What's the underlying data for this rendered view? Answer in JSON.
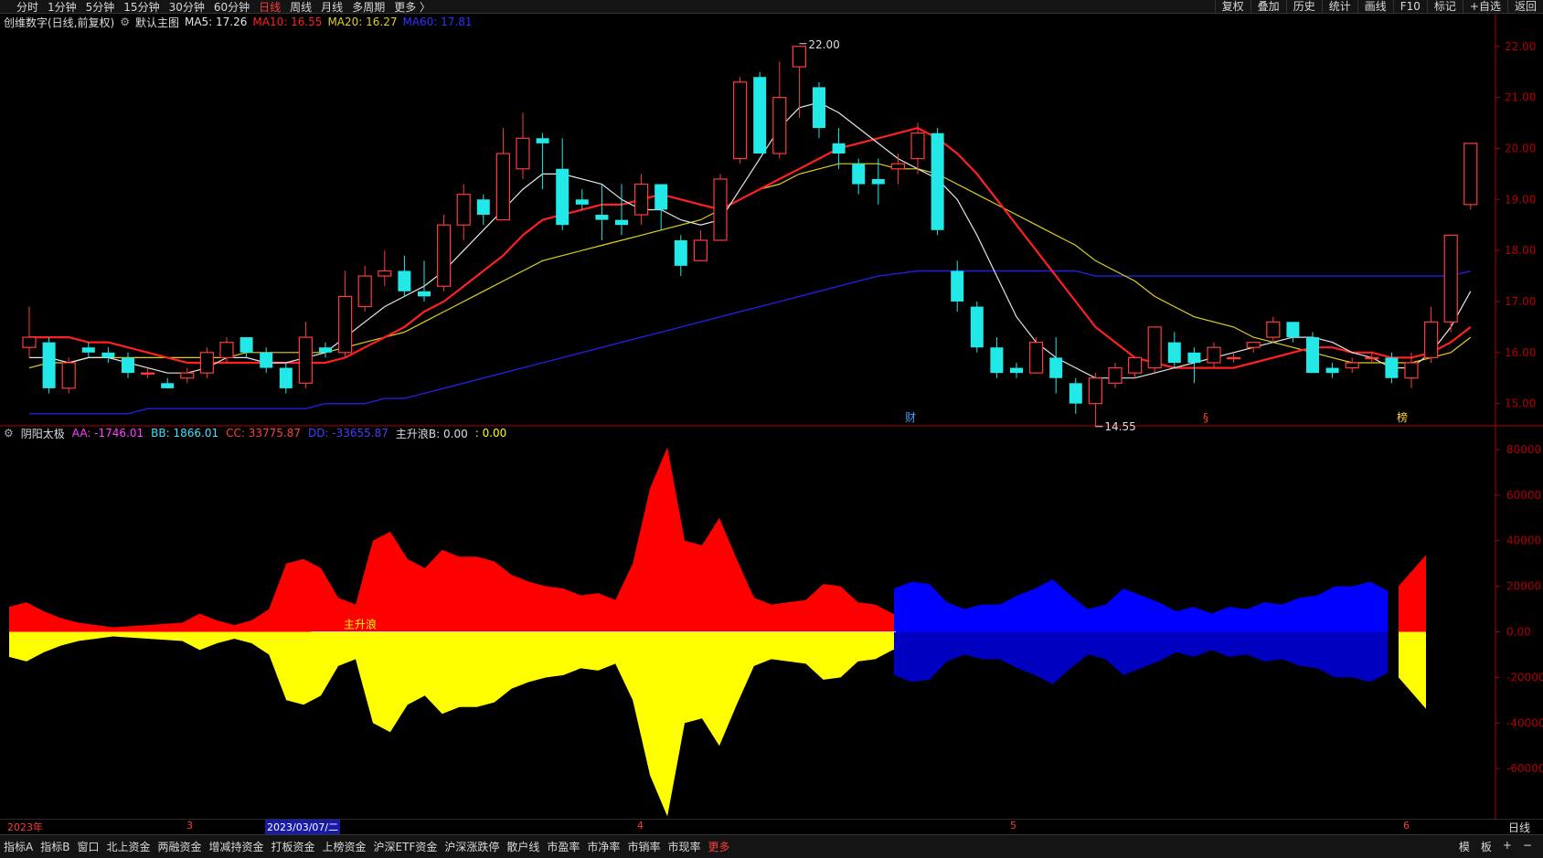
{
  "top_toolbar": {
    "periods": [
      "分时",
      "1分钟",
      "5分钟",
      "15分钟",
      "30分钟",
      "60分钟",
      "日线",
      "周线",
      "月线",
      "多周期",
      "更多 〉"
    ],
    "active_period": "日线",
    "tools": [
      "复权",
      "叠加",
      "历史",
      "统计",
      "画线",
      "F10",
      "标记",
      "+自选",
      "返回"
    ]
  },
  "main_legend": {
    "name": "创维数字(日线,前复权)",
    "main_chart": "默认主图",
    "ma5": "MA5: 17.26",
    "ma10": "MA10: 16.55",
    "ma20": "MA20: 16.27",
    "ma60": "MA60: 17.81"
  },
  "indicator_legend": {
    "name": "阴阳太极",
    "aa": "AA: -1746.01",
    "bb": "BB: 1866.01",
    "cc": "CC: 33775.87",
    "dd": "DD: -33655.87",
    "zsl": "主升浪B: 0.00",
    "extra": ": 0.00",
    "zsl_mark": "主升浪"
  },
  "colors": {
    "up": "#ff3b3b",
    "down": "#22e8e8",
    "ma5": "#e6e6e6",
    "ma10": "#ff2020",
    "ma20": "#e0d020",
    "ma60": "#2020e0",
    "axis": "#b00000",
    "aa": "#ff40ff",
    "bb": "#40e0ff",
    "cc": "#ff4040",
    "dd": "#4040ff",
    "yellow": "#ffff00"
  },
  "chart_data": [
    {
      "type": "candlestick",
      "title": "创维数字(日线,前复权)",
      "ylim": [
        14.6,
        22.3
      ],
      "y_ticks": [
        "22.00",
        "21.00",
        "20.00",
        "19.00",
        "18.00",
        "17.00",
        "16.00",
        "15.00"
      ],
      "annotations": {
        "high": "22.00",
        "low": "14.55",
        "event1": "财",
        "event2": "§",
        "event3": "榜"
      },
      "candles": [
        [
          16.1,
          16.3,
          16.9,
          15.9
        ],
        [
          16.2,
          15.3,
          16.3,
          15.2
        ],
        [
          15.3,
          15.8,
          15.9,
          15.2
        ],
        [
          16.1,
          16.0,
          16.2,
          15.9
        ],
        [
          16.0,
          15.9,
          16.1,
          15.8
        ],
        [
          15.9,
          15.6,
          16.0,
          15.5
        ],
        [
          15.6,
          15.6,
          15.7,
          15.5
        ],
        [
          15.4,
          15.3,
          15.5,
          15.3
        ],
        [
          15.5,
          15.6,
          15.7,
          15.4
        ],
        [
          15.6,
          16.0,
          16.1,
          15.5
        ],
        [
          15.9,
          16.2,
          16.3,
          15.8
        ],
        [
          16.3,
          16.0,
          16.3,
          15.9
        ],
        [
          16.0,
          15.7,
          16.1,
          15.6
        ],
        [
          15.7,
          15.3,
          15.8,
          15.2
        ],
        [
          15.4,
          16.3,
          16.6,
          15.3
        ],
        [
          16.1,
          16.0,
          16.2,
          15.9
        ],
        [
          16.0,
          17.1,
          17.6,
          15.9
        ],
        [
          16.9,
          17.5,
          17.7,
          16.8
        ],
        [
          17.5,
          17.6,
          18.0,
          17.3
        ],
        [
          17.6,
          17.2,
          17.9,
          17.1
        ],
        [
          17.2,
          17.1,
          17.8,
          17.0
        ],
        [
          17.3,
          18.5,
          18.7,
          17.2
        ],
        [
          18.5,
          19.1,
          19.3,
          18.2
        ],
        [
          19.0,
          18.7,
          19.1,
          18.5
        ],
        [
          18.6,
          19.9,
          20.4,
          18.6
        ],
        [
          19.6,
          20.2,
          20.7,
          19.4
        ],
        [
          20.2,
          20.1,
          20.3,
          19.2
        ],
        [
          19.6,
          18.5,
          20.2,
          18.4
        ],
        [
          19.0,
          18.9,
          19.2,
          18.8
        ],
        [
          18.7,
          18.6,
          19.3,
          18.2
        ],
        [
          18.6,
          18.5,
          19.3,
          18.3
        ],
        [
          18.7,
          19.3,
          19.5,
          18.5
        ],
        [
          19.3,
          18.8,
          19.3,
          18.4
        ],
        [
          18.2,
          17.7,
          18.3,
          17.5
        ],
        [
          17.8,
          18.2,
          18.4,
          17.8
        ],
        [
          18.2,
          19.4,
          19.5,
          18.2
        ],
        [
          19.8,
          21.3,
          21.4,
          19.7
        ],
        [
          21.4,
          19.9,
          21.5,
          19.9
        ],
        [
          19.9,
          21.0,
          21.7,
          19.8
        ],
        [
          21.6,
          22.0,
          22.0,
          20.6
        ],
        [
          21.2,
          20.4,
          21.3,
          20.2
        ],
        [
          20.1,
          19.9,
          20.4,
          19.6
        ],
        [
          19.7,
          19.3,
          19.8,
          19.1
        ],
        [
          19.4,
          19.3,
          19.8,
          18.9
        ],
        [
          19.6,
          19.7,
          19.9,
          19.3
        ],
        [
          19.8,
          20.3,
          20.5,
          19.5
        ],
        [
          20.3,
          18.4,
          20.4,
          18.3
        ],
        [
          17.6,
          17.0,
          17.8,
          16.8
        ],
        [
          16.9,
          16.1,
          17.0,
          16.0
        ],
        [
          16.1,
          15.6,
          16.3,
          15.5
        ],
        [
          15.7,
          15.6,
          15.8,
          15.5
        ],
        [
          15.6,
          16.2,
          16.3,
          15.6
        ],
        [
          15.9,
          15.5,
          16.3,
          15.2
        ],
        [
          15.4,
          15.0,
          15.5,
          14.8
        ],
        [
          15.0,
          15.5,
          15.6,
          14.55
        ],
        [
          15.4,
          15.7,
          15.8,
          15.3
        ],
        [
          15.6,
          15.9,
          15.9,
          15.5
        ],
        [
          15.7,
          16.5,
          16.5,
          15.6
        ],
        [
          16.2,
          15.8,
          16.4,
          15.7
        ],
        [
          16.0,
          15.8,
          16.1,
          15.4
        ],
        [
          15.8,
          16.1,
          16.2,
          15.7
        ],
        [
          15.9,
          15.9,
          16.0,
          15.8
        ],
        [
          16.1,
          16.2,
          16.2,
          16.0
        ],
        [
          16.3,
          16.6,
          16.7,
          16.2
        ],
        [
          16.6,
          16.3,
          16.6,
          16.2
        ],
        [
          16.3,
          15.6,
          16.4,
          15.6
        ],
        [
          15.7,
          15.6,
          15.8,
          15.5
        ],
        [
          15.7,
          15.8,
          15.9,
          15.6
        ],
        [
          15.9,
          15.9,
          16.0,
          15.8
        ],
        [
          15.9,
          15.5,
          16.0,
          15.4
        ],
        [
          15.5,
          15.8,
          16.0,
          15.3
        ],
        [
          15.9,
          16.6,
          16.9,
          15.8
        ],
        [
          16.6,
          18.3,
          18.3,
          16.4
        ],
        [
          18.9,
          20.1,
          20.1,
          18.8
        ]
      ],
      "ma5": [
        15.9,
        15.9,
        15.8,
        15.9,
        15.9,
        15.8,
        15.7,
        15.6,
        15.6,
        15.7,
        15.9,
        15.9,
        15.8,
        15.8,
        15.9,
        16.0,
        16.3,
        16.6,
        16.9,
        17.1,
        17.3,
        17.6,
        18.0,
        18.4,
        18.8,
        19.2,
        19.5,
        19.5,
        19.4,
        19.3,
        19.0,
        18.8,
        18.8,
        18.6,
        18.5,
        18.6,
        19.2,
        19.8,
        20.4,
        20.8,
        20.9,
        20.7,
        20.4,
        20.1,
        19.8,
        19.6,
        19.4,
        19.0,
        18.3,
        17.5,
        16.7,
        16.2,
        15.9,
        15.7,
        15.5,
        15.5,
        15.5,
        15.6,
        15.7,
        15.8,
        15.9,
        16.0,
        16.1,
        16.2,
        16.3,
        16.3,
        16.2,
        16.0,
        15.9,
        15.7,
        15.7,
        16.0,
        16.5,
        17.2
      ],
      "ma10": [
        16.3,
        16.3,
        16.3,
        16.2,
        16.2,
        16.1,
        16.0,
        15.9,
        15.8,
        15.8,
        15.8,
        15.8,
        15.8,
        15.8,
        15.8,
        15.8,
        15.9,
        16.1,
        16.3,
        16.5,
        16.8,
        17.0,
        17.3,
        17.6,
        17.9,
        18.3,
        18.6,
        18.7,
        18.8,
        18.9,
        18.9,
        19.0,
        19.1,
        19.0,
        18.9,
        18.8,
        19.0,
        19.2,
        19.4,
        19.6,
        19.8,
        20.0,
        20.1,
        20.2,
        20.3,
        20.4,
        20.2,
        19.9,
        19.5,
        19.0,
        18.5,
        18.0,
        17.5,
        17.0,
        16.5,
        16.2,
        15.9,
        15.8,
        15.7,
        15.7,
        15.7,
        15.7,
        15.8,
        15.9,
        16.0,
        16.1,
        16.1,
        16.0,
        16.0,
        15.9,
        15.9,
        16.0,
        16.2,
        16.5
      ],
      "ma20": [
        15.7,
        15.8,
        15.8,
        15.9,
        15.9,
        15.9,
        15.9,
        15.9,
        15.9,
        15.9,
        15.9,
        16.0,
        16.0,
        16.0,
        16.0,
        16.0,
        16.1,
        16.2,
        16.3,
        16.4,
        16.6,
        16.8,
        17.0,
        17.2,
        17.4,
        17.6,
        17.8,
        17.9,
        18.0,
        18.1,
        18.2,
        18.3,
        18.4,
        18.5,
        18.6,
        18.8,
        19.0,
        19.2,
        19.3,
        19.5,
        19.6,
        19.7,
        19.7,
        19.7,
        19.6,
        19.6,
        19.5,
        19.3,
        19.1,
        18.9,
        18.7,
        18.5,
        18.3,
        18.1,
        17.8,
        17.6,
        17.4,
        17.1,
        16.9,
        16.7,
        16.6,
        16.5,
        16.3,
        16.2,
        16.1,
        16.0,
        15.9,
        15.8,
        15.8,
        15.8,
        15.8,
        15.9,
        16.0,
        16.3
      ],
      "ma60": [
        14.8,
        14.8,
        14.8,
        14.8,
        14.8,
        14.8,
        14.9,
        14.9,
        14.9,
        14.9,
        14.9,
        14.9,
        14.9,
        14.9,
        14.9,
        15.0,
        15.0,
        15.0,
        15.1,
        15.1,
        15.2,
        15.3,
        15.4,
        15.5,
        15.6,
        15.7,
        15.8,
        15.9,
        16.0,
        16.1,
        16.2,
        16.3,
        16.4,
        16.5,
        16.6,
        16.7,
        16.8,
        16.9,
        17.0,
        17.1,
        17.2,
        17.3,
        17.4,
        17.5,
        17.55,
        17.6,
        17.6,
        17.6,
        17.6,
        17.6,
        17.6,
        17.6,
        17.6,
        17.6,
        17.5,
        17.5,
        17.5,
        17.5,
        17.5,
        17.5,
        17.5,
        17.5,
        17.5,
        17.5,
        17.5,
        17.5,
        17.5,
        17.5,
        17.5,
        17.5,
        17.5,
        17.5,
        17.5,
        17.6
      ]
    },
    {
      "type": "area",
      "title": "阴阳太极",
      "ylim": [
        -82000,
        84000
      ],
      "y_ticks": [
        "80000",
        "60000",
        "40000",
        "20000",
        "0.00",
        "-20000",
        "-40000",
        "-60000"
      ],
      "series": [
        {
          "name": "CC",
          "values": [
            11000,
            13000,
            9000,
            6000,
            4000,
            3000,
            2000,
            2500,
            3000,
            3500,
            4000,
            8000,
            5000,
            3000,
            5000,
            10000,
            30000,
            32000,
            28000,
            15000,
            12000,
            40000,
            44000,
            32000,
            28000,
            36000,
            33000,
            33000,
            31000,
            25000,
            22000,
            20000,
            19000,
            16000,
            17000,
            14000,
            30000,
            63000,
            81000,
            40000,
            38000,
            50000,
            32000,
            15000,
            12000,
            13000,
            14000,
            21000,
            20000,
            13000,
            12000,
            8000,
            7000
          ]
        },
        {
          "name": "DD",
          "values": [
            -11000,
            -13000,
            -9000,
            -6000,
            -4000,
            -3000,
            -2000,
            -2500,
            -3000,
            -3500,
            -4000,
            -8000,
            -5000,
            -3000,
            -5000,
            -10000,
            -30000,
            -32000,
            -28000,
            -15000,
            -12000,
            -40000,
            -44000,
            -32000,
            -28000,
            -36000,
            -33000,
            -33000,
            -31000,
            -25000,
            -22000,
            -20000,
            -19000,
            -16000,
            -17000,
            -14000,
            -30000,
            -63000,
            -81000,
            -40000,
            -38000,
            -50000,
            -32000,
            -15000,
            -12000,
            -13000,
            -14000,
            -21000,
            -20000,
            -13000,
            -12000,
            -8000,
            -7000
          ]
        },
        {
          "name": "BB",
          "values": [
            19000,
            22000,
            21000,
            13000,
            10000,
            12000,
            12000,
            16000,
            19000,
            23000,
            16000,
            10000,
            12000,
            19000,
            16000,
            13000,
            9000,
            11000,
            8000,
            11000,
            10000,
            13000,
            12000,
            15000,
            16000,
            20000,
            20000,
            22000,
            18000
          ]
        },
        {
          "name": "AA",
          "values": [
            -19000,
            -22000,
            -21000,
            -13000,
            -10000,
            -12000,
            -12000,
            -16000,
            -19000,
            -23000,
            -16000,
            -10000,
            -12000,
            -19000,
            -16000,
            -13000,
            -9000,
            -11000,
            -8000,
            -11000,
            -10000,
            -13000,
            -12000,
            -15000,
            -16000,
            -20000,
            -20000,
            -22000,
            -18000
          ]
        },
        {
          "name": "CC-tail",
          "values": [
            20000,
            33775.87
          ]
        }
      ]
    }
  ],
  "x_axis": {
    "labels": [
      {
        "text": "2023年"
      },
      {
        "text": "3"
      },
      {
        "text": "4"
      },
      {
        "text": "5"
      },
      {
        "text": "6"
      }
    ],
    "selected_date": "2023/03/07/二",
    "period": "日线"
  },
  "bottom_tabs": [
    "指标A",
    "指标B",
    "窗口",
    "北上资金",
    "两融资金",
    "增减持资金",
    "打板资金",
    "上榜资金",
    "沪深ETF资金",
    "沪深涨跌停",
    "散户线",
    "市盈率",
    "市净率",
    "市销率",
    "市现率",
    "更多"
  ],
  "bottom_right": [
    "模",
    "板",
    "+",
    "−"
  ]
}
